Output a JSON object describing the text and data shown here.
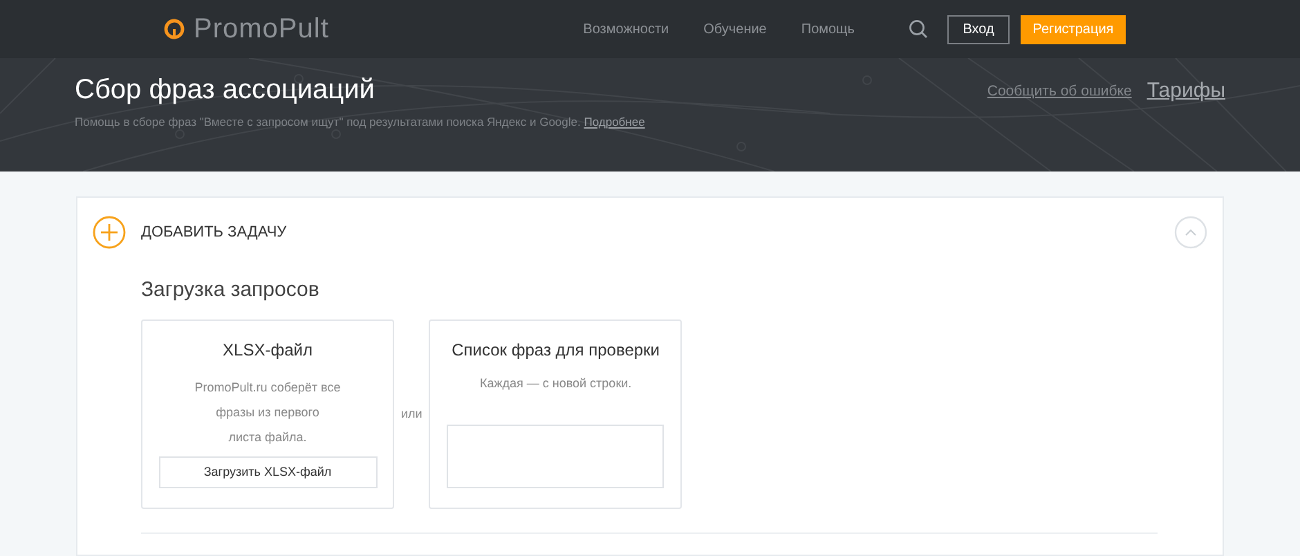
{
  "header": {
    "logo": "PromoPult",
    "nav": [
      "Возможности",
      "Обучение",
      "Помощь"
    ],
    "login": "Вход",
    "register": "Регистрация"
  },
  "hero": {
    "title": "Сбор фраз ассоциаций",
    "subtitle": "Помощь в сборе фраз \"Вместе с запросом ищут\" под результатами поиска Яндекс и Google.",
    "more_link": "Подробнее",
    "report_link": "Сообщить об ошибке",
    "pricing_link": "Тарифы"
  },
  "task": {
    "title": "ДОБАВИТЬ ЗАДАЧУ",
    "expanded": true,
    "section_title": "Загрузка запросов",
    "file_box": {
      "title": "XLSX-файл",
      "lines": [
        "PromoPult.ru соберёт все",
        "фразы из первого",
        "листа файла."
      ],
      "button": "Загрузить XLSX-файл"
    },
    "separator": "или",
    "list_box": {
      "title": "Список фраз для проверки",
      "hint": "Каждая — с новой строки."
    }
  }
}
